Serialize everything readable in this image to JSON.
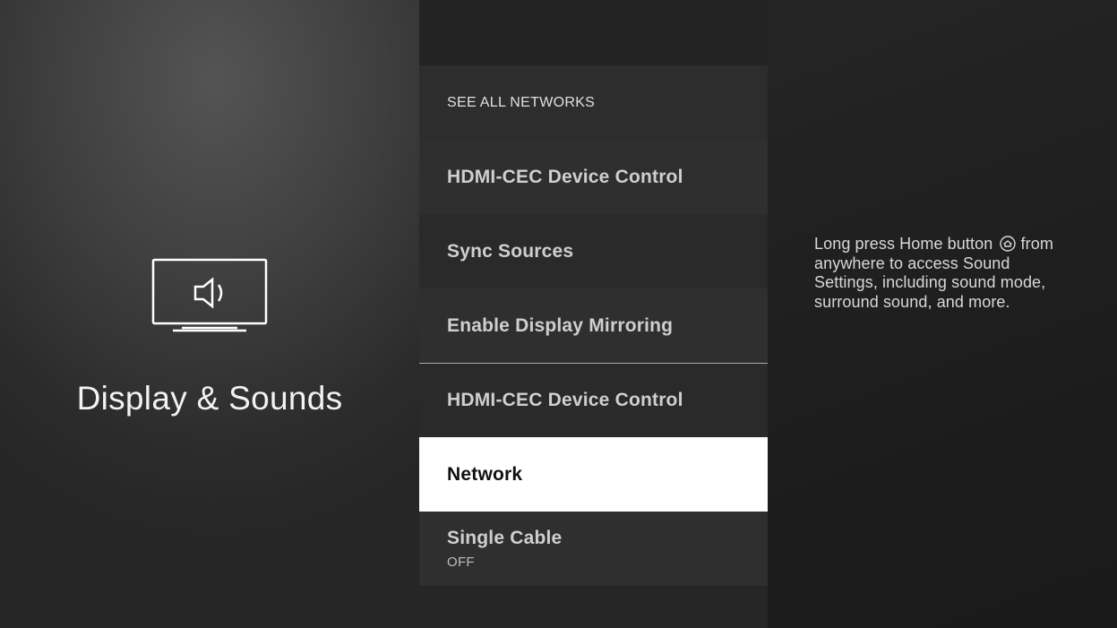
{
  "section": {
    "title": "Display & Sounds",
    "icon": "tv-speaker-icon"
  },
  "menu": {
    "header": "SEE ALL NETWORKS",
    "items": [
      {
        "label": "HDMI-CEC Device Control",
        "sublabel": ""
      },
      {
        "label": "Sync Sources",
        "sublabel": ""
      },
      {
        "label": "Enable Display Mirroring",
        "sublabel": ""
      },
      {
        "label": "HDMI-CEC Device Control",
        "sublabel": ""
      },
      {
        "label": "Network",
        "sublabel": "",
        "selected": true
      },
      {
        "label": "Single Cable",
        "sublabel": "OFF"
      }
    ]
  },
  "help": {
    "text_before_icon": "Long press Home button",
    "text_after_icon": "from anywhere to access Sound Settings, including sound mode, surround sound, and more.",
    "icon": "home-button-icon"
  },
  "colors": {
    "selected_bg": "#ffffff",
    "selected_text": "#111111",
    "text": "#cfcfcf"
  }
}
